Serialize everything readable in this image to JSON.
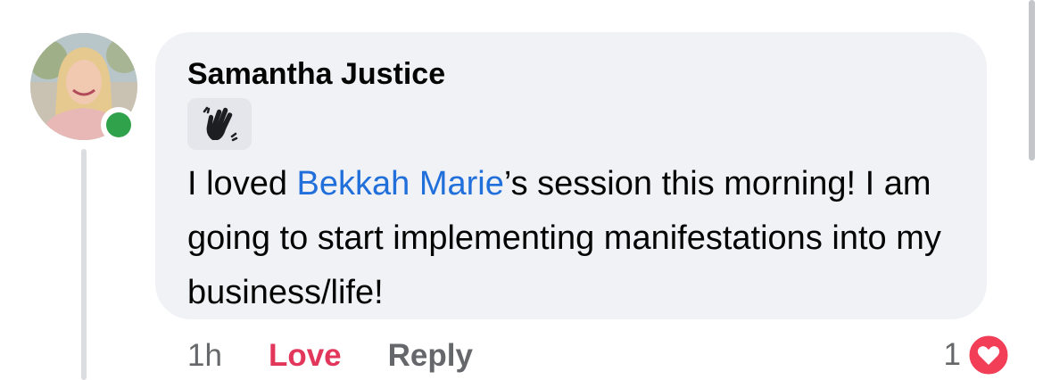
{
  "comment": {
    "author": "Samantha Justice",
    "badge_icon": "waving-hand-icon",
    "text_before_mention": "I loved ",
    "mention": "Bekkah Marie",
    "text_after_mention": "’s session this morning! I am going to start implementing manifestations into my business/life!",
    "timestamp": "1h",
    "love_label": "Love",
    "reply_label": "Reply",
    "reaction_count": "1",
    "reaction_icon": "heart-reaction-icon",
    "online": true
  },
  "colors": {
    "bubble": "#f0f2f5",
    "mention": "#216fdb",
    "love": "#e2375b",
    "online": "#31a24c",
    "muted": "#65676b"
  }
}
